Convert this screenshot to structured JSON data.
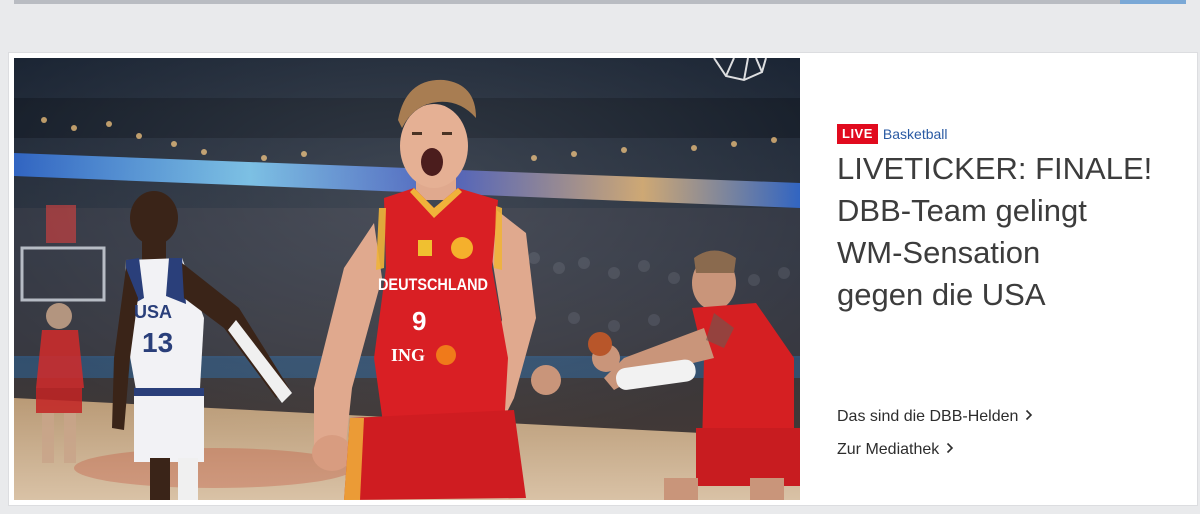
{
  "teaser": {
    "badge": "LIVE",
    "category": "Basketball",
    "headline_lines": [
      "LIVETICKER: FINALE!",
      "DBB-Team gelingt",
      "WM-Sensation",
      "gegen die USA"
    ],
    "links": [
      {
        "label": "Das sind die DBB-Helden"
      },
      {
        "label": "Zur Mediathek"
      }
    ]
  },
  "image": {
    "jersey_text": "DEUTSCHLAND",
    "jersey_number": "9",
    "sponsor": "ING",
    "opponent_jersey_text": "USA",
    "opponent_jersey_number": "13"
  },
  "colors": {
    "live_red": "#e10a1e",
    "category_blue": "#2a5aa3",
    "headline_gray": "#3c3c3c"
  }
}
